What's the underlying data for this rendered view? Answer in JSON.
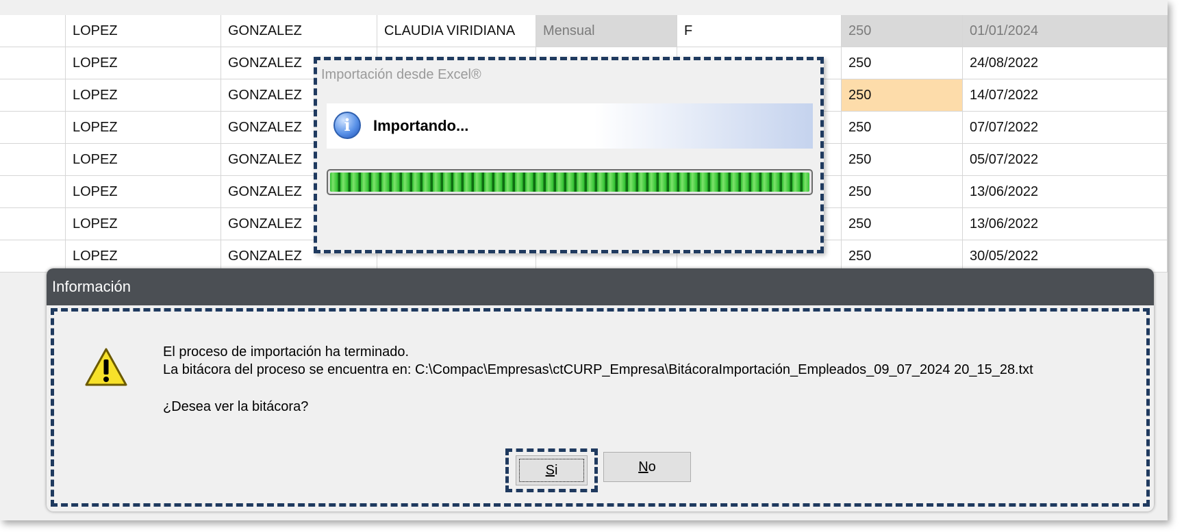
{
  "grid": {
    "rows": [
      {
        "c1": "LOPEZ",
        "c2": "GONZALEZ",
        "c3": "CLAUDIA VIRIDIANA",
        "c4": "Mensual",
        "c5": "F",
        "c6": "250",
        "c7": "01/01/2024"
      },
      {
        "c1": "LOPEZ",
        "c2": "GONZALEZ",
        "c3": "",
        "c4": "",
        "c5": "",
        "c6": "250",
        "c7": "24/08/2022"
      },
      {
        "c1": "LOPEZ",
        "c2": "GONZALEZ",
        "c3": "",
        "c4": "",
        "c5": "",
        "c6": "250",
        "c7": "14/07/2022"
      },
      {
        "c1": "LOPEZ",
        "c2": "GONZALEZ",
        "c3": "",
        "c4": "",
        "c5": "",
        "c6": "250",
        "c7": "07/07/2022"
      },
      {
        "c1": "LOPEZ",
        "c2": "GONZALEZ",
        "c3": "",
        "c4": "",
        "c5": "",
        "c6": "250",
        "c7": "05/07/2022"
      },
      {
        "c1": "LOPEZ",
        "c2": "GONZALEZ",
        "c3": "",
        "c4": "",
        "c5": "",
        "c6": "250",
        "c7": "13/06/2022"
      },
      {
        "c1": "LOPEZ",
        "c2": "GONZALEZ",
        "c3": "",
        "c4": "",
        "c5": "",
        "c6": "250",
        "c7": "13/06/2022"
      },
      {
        "c1": "LOPEZ",
        "c2": "GONZALEZ",
        "c3": "",
        "c4": "",
        "c5": "",
        "c6": "250",
        "c7": "30/05/2022"
      }
    ]
  },
  "import_dialog": {
    "title": "Importación desde Excel®",
    "status": "Importando...",
    "info_icon": "i",
    "progress": 1.0,
    "progress_color": "#2fc030"
  },
  "info_dialog": {
    "title": "Información",
    "message_line1": "El proceso de importación ha terminado.",
    "message_line2": "La bitácora del proceso se encuentra en: C:\\Compac\\Empresas\\ctCURP_Empresa\\BitácoraImportación_Empleados_09_07_2024 20_15_28.txt",
    "question": "¿Desea ver la bitácora?",
    "yes_label": "Si",
    "no_label": "No",
    "icon": "warning-icon"
  },
  "colors": {
    "highlight": "#fddcaa",
    "titlebar": "#4b4f54",
    "annotation": "#1f3a5f"
  }
}
